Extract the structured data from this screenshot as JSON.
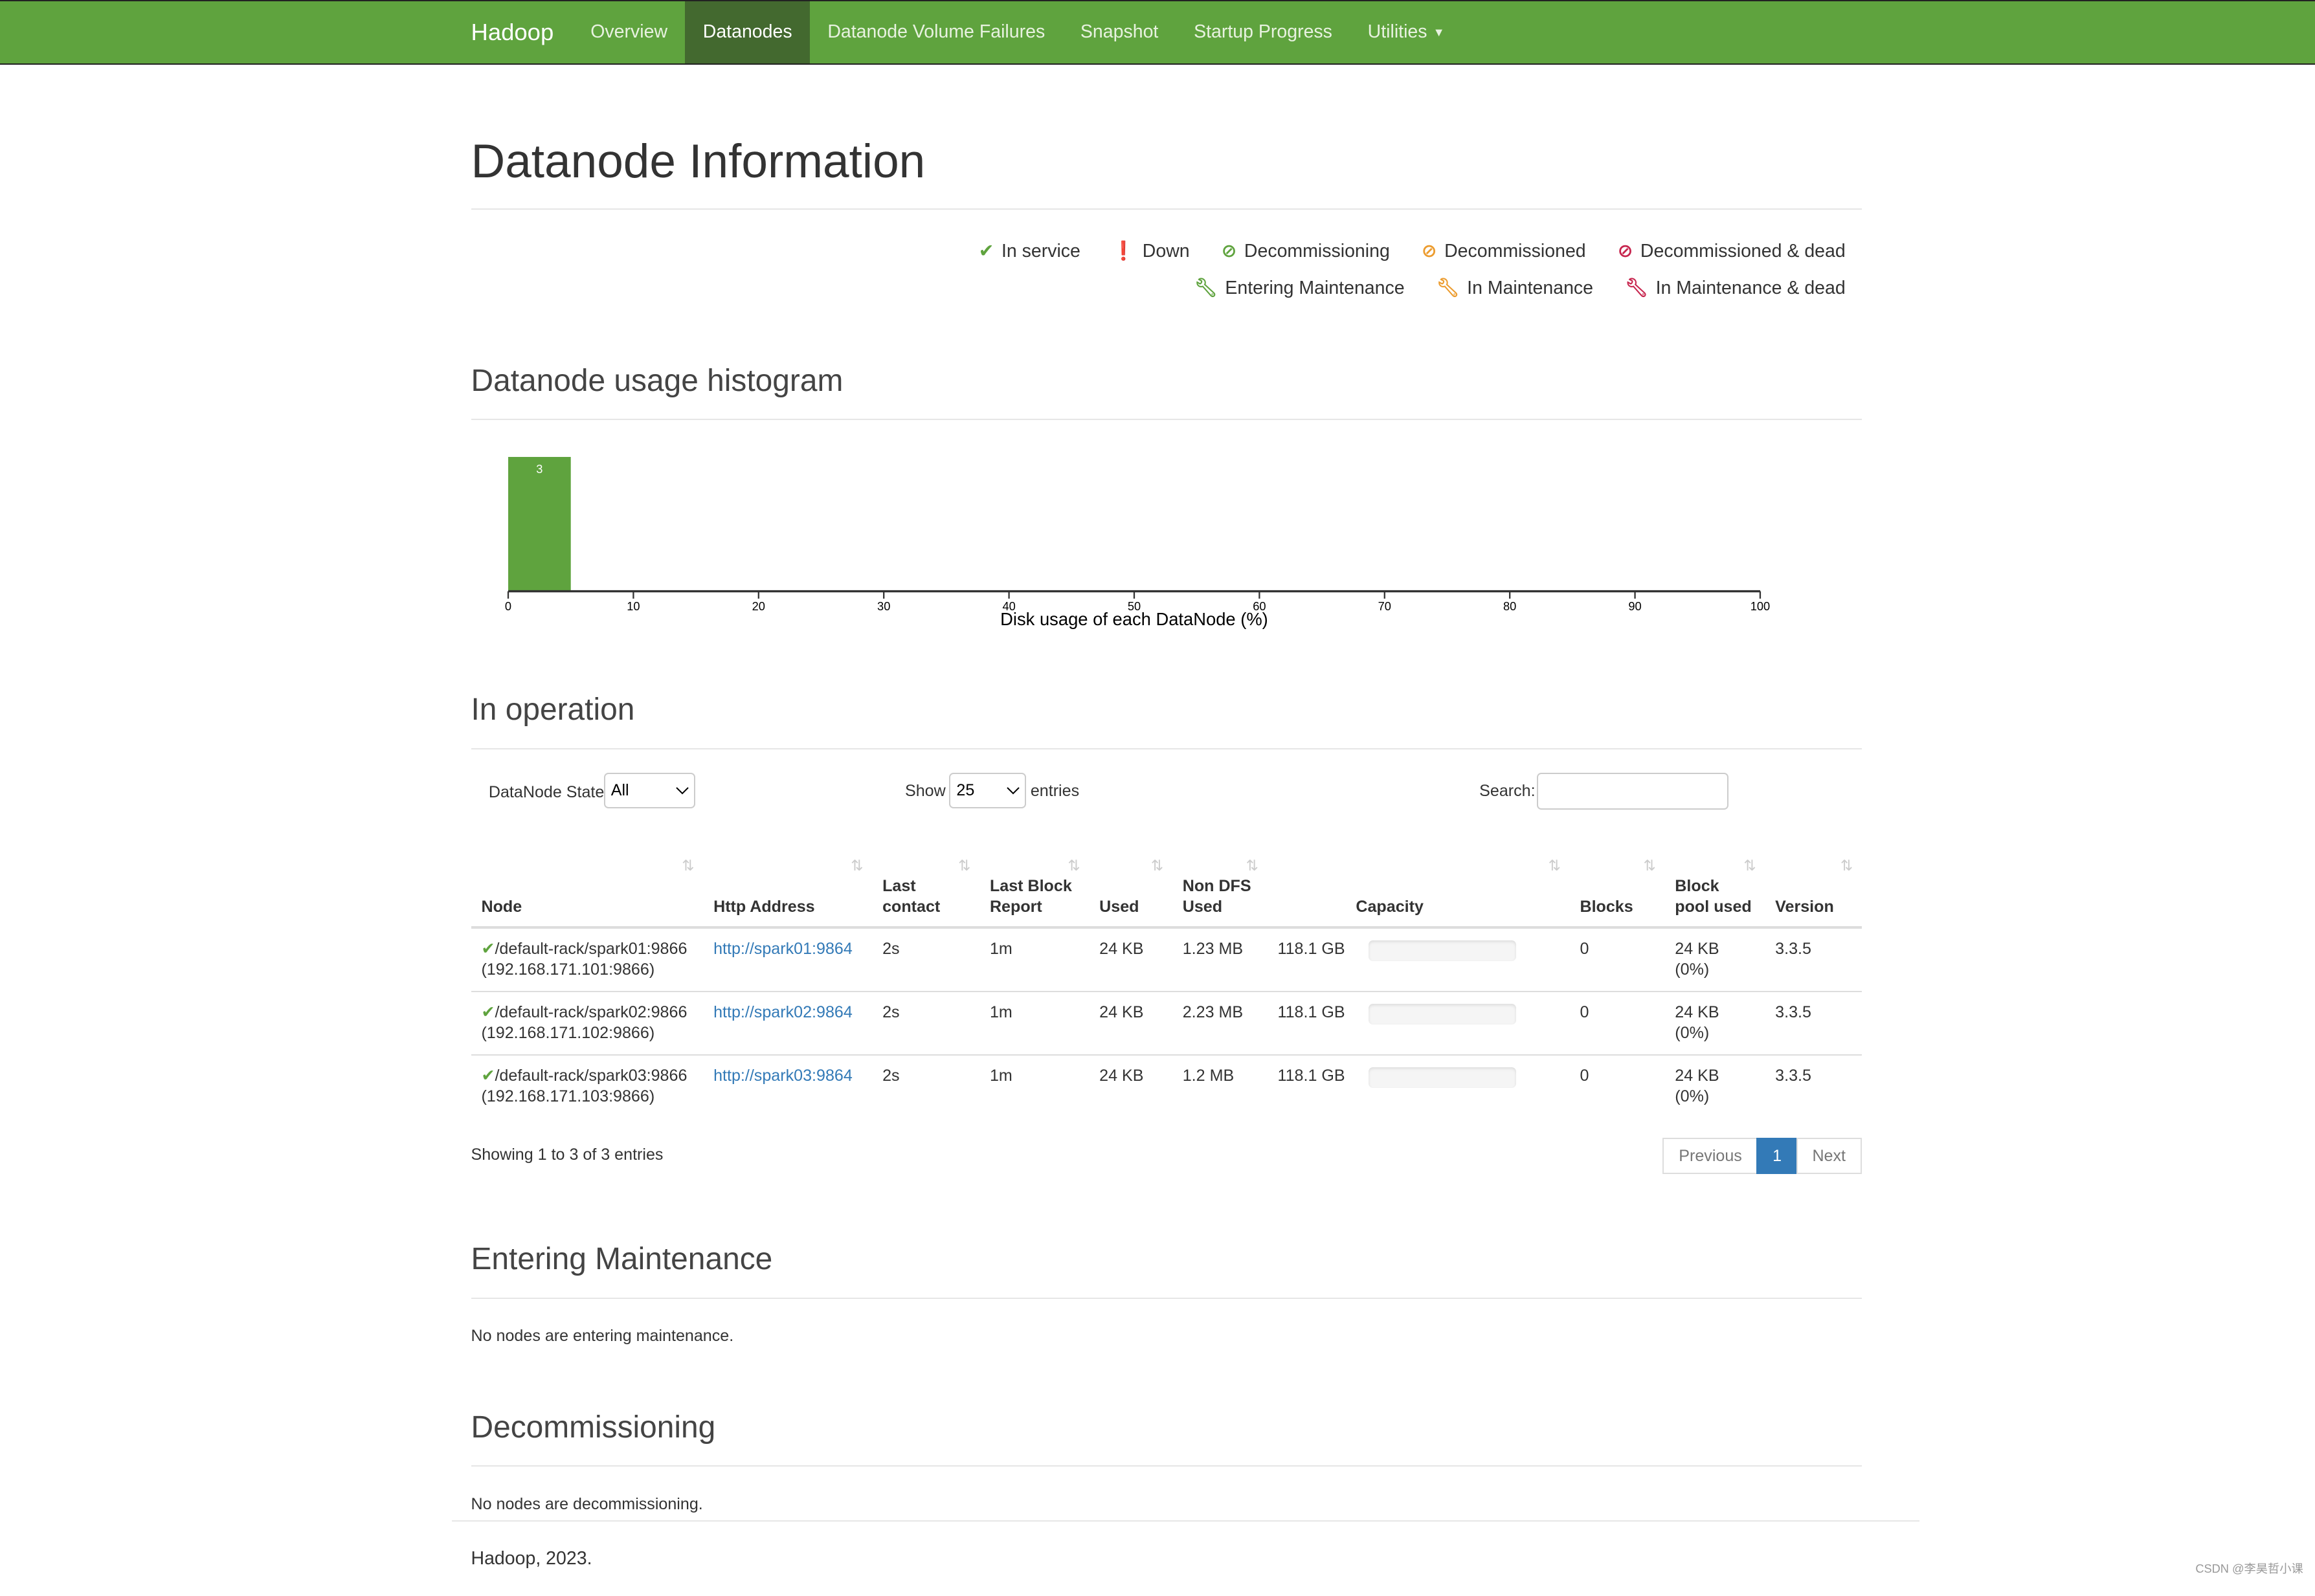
{
  "nav": {
    "brand": "Hadoop",
    "items": [
      {
        "label": "Overview"
      },
      {
        "label": "Datanodes",
        "active": true
      },
      {
        "label": "Datanode Volume Failures"
      },
      {
        "label": "Snapshot"
      },
      {
        "label": "Startup Progress"
      },
      {
        "label": "Utilities"
      }
    ]
  },
  "title": "Datanode Information",
  "legend": [
    {
      "label": "In service",
      "icon": "check-icon",
      "color": "#5fa33e"
    },
    {
      "label": "Down",
      "icon": "exclamation-icon",
      "color": "#c7254e"
    },
    {
      "label": "Decommissioning",
      "icon": "ban-icon",
      "color": "#5fa33e"
    },
    {
      "label": "Decommissioned",
      "icon": "ban-icon",
      "color": "#ec9c2f"
    },
    {
      "label": "Decommissioned & dead",
      "icon": "ban-icon",
      "color": "#c7254e"
    },
    {
      "label": "Entering Maintenance",
      "icon": "wrench-icon",
      "color": "#5fa33e"
    },
    {
      "label": "In Maintenance",
      "icon": "wrench-icon",
      "color": "#ec9c2f"
    },
    {
      "label": "In Maintenance & dead",
      "icon": "wrench-icon",
      "color": "#c7254e"
    }
  ],
  "histogram": {
    "heading": "Datanode usage histogram"
  },
  "chart_data": {
    "type": "bar",
    "bins": [
      {
        "from": 0,
        "to": 5,
        "count": 3
      }
    ],
    "xlabel": "Disk usage of each DataNode (%)",
    "xlim": [
      0,
      100
    ],
    "xticks": [
      0,
      10,
      20,
      30,
      40,
      50,
      60,
      70,
      80,
      90,
      100
    ],
    "color": "#5fa33e",
    "grid": false
  },
  "operation": {
    "heading": "In operation",
    "state_label": "DataNode State",
    "state_value": "All",
    "show_label": "Show",
    "show_value": "25",
    "entries_label": "entries",
    "search_label": "Search:",
    "search_value": "",
    "columns": [
      "Node",
      "Http Address",
      "Last contact",
      "Last Block Report",
      "Used",
      "Non DFS Used",
      "Capacity",
      "Blocks",
      "Block pool used",
      "Version"
    ],
    "rows": [
      {
        "node": "/default-rack/spark01:9866",
        "ip": "(192.168.171.101:9866)",
        "http": "http://spark01:9864",
        "contact": "2s",
        "report": "1m",
        "used": "24 KB",
        "nondfs": "1.23 MB",
        "capacity": "118.1 GB",
        "blocks": "0",
        "bpused": "24 KB (0%)",
        "version": "3.3.5"
      },
      {
        "node": "/default-rack/spark02:9866",
        "ip": "(192.168.171.102:9866)",
        "http": "http://spark02:9864",
        "contact": "2s",
        "report": "1m",
        "used": "24 KB",
        "nondfs": "2.23 MB",
        "capacity": "118.1 GB",
        "blocks": "0",
        "bpused": "24 KB (0%)",
        "version": "3.3.5"
      },
      {
        "node": "/default-rack/spark03:9866",
        "ip": "(192.168.171.103:9866)",
        "http": "http://spark03:9864",
        "contact": "2s",
        "report": "1m",
        "used": "24 KB",
        "nondfs": "1.2 MB",
        "capacity": "118.1 GB",
        "blocks": "0",
        "bpused": "24 KB (0%)",
        "version": "3.3.5"
      }
    ],
    "info": "Showing 1 to 3 of 3 entries",
    "prev": "Previous",
    "page": "1",
    "next": "Next"
  },
  "entering": {
    "heading": "Entering Maintenance",
    "text": "No nodes are entering maintenance."
  },
  "decom": {
    "heading": "Decommissioning",
    "text": "No nodes are decommissioning."
  },
  "footer": "Hadoop, 2023.",
  "watermark": "CSDN @李昊哲小课"
}
